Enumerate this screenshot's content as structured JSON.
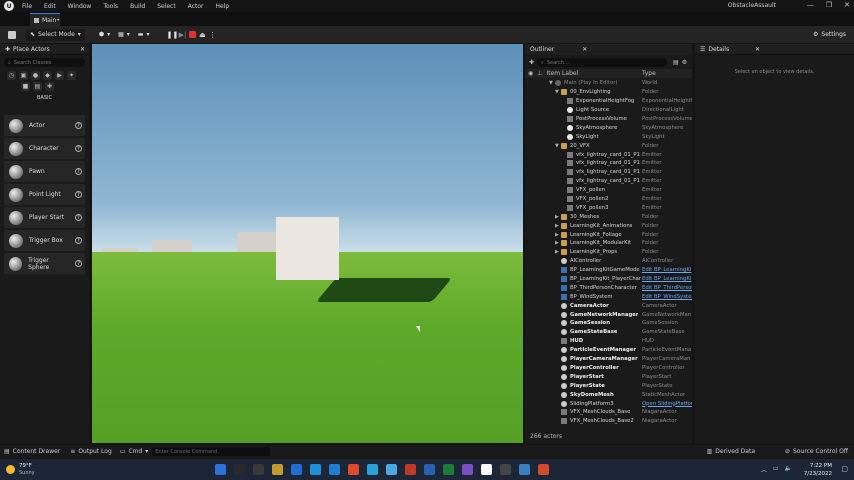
{
  "menubar": {
    "logo": "U",
    "items": [
      "File",
      "Edit",
      "Window",
      "Tools",
      "Build",
      "Select",
      "Actor",
      "Help"
    ],
    "project_name": "ObstacleAssault",
    "window_buttons": [
      "—",
      "❐",
      "✕"
    ]
  },
  "tabs": {
    "main": "Main•"
  },
  "toolbar": {
    "select_mode": "Select Mode",
    "settings": "Settings"
  },
  "place_actors": {
    "title": "Place Actors",
    "search_placeholder": "Search Classes",
    "section": "BASIC",
    "actors": [
      "Actor",
      "Character",
      "Pawn",
      "Point Light",
      "Player Start",
      "Trigger Box",
      "Trigger Sphere"
    ]
  },
  "outliner": {
    "title": "Outliner",
    "search_placeholder": "Search...",
    "col_label": "Item Label",
    "col_type": "Type",
    "rows": [
      {
        "indent": 0,
        "arrow": "▼",
        "icon": "world",
        "label": "Main (Play In Editor)",
        "type": "World",
        "dim": true
      },
      {
        "indent": 1,
        "arrow": "▼",
        "icon": "folder",
        "label": "00_EnvLighting",
        "type": "Folder"
      },
      {
        "indent": 2,
        "arrow": "",
        "icon": "fx",
        "label": "ExponentialHeightFog",
        "type": "ExponentialHeightF"
      },
      {
        "indent": 2,
        "arrow": "",
        "icon": "light",
        "label": "Light Source",
        "type": "DirectionalLight"
      },
      {
        "indent": 2,
        "arrow": "",
        "icon": "fx",
        "label": "PostProcessVolume",
        "type": "PostProcessVolume"
      },
      {
        "indent": 2,
        "arrow": "",
        "icon": "light",
        "label": "SkyAtmosphere",
        "type": "SkyAtmosphere"
      },
      {
        "indent": 2,
        "arrow": "",
        "icon": "light",
        "label": "SkyLight",
        "type": "SkyLight"
      },
      {
        "indent": 1,
        "arrow": "▼",
        "icon": "folder",
        "label": "20_VFX",
        "type": "Folder"
      },
      {
        "indent": 2,
        "arrow": "",
        "icon": "fx",
        "label": "vfx_lightray_card_01_P1",
        "type": "Emitter"
      },
      {
        "indent": 2,
        "arrow": "",
        "icon": "fx",
        "label": "vfx_lightray_card_01_P1",
        "type": "Emitter"
      },
      {
        "indent": 2,
        "arrow": "",
        "icon": "fx",
        "label": "vfx_lightray_card_01_P1",
        "type": "Emitter"
      },
      {
        "indent": 2,
        "arrow": "",
        "icon": "fx",
        "label": "vfx_lightray_card_01_P1",
        "type": "Emitter"
      },
      {
        "indent": 2,
        "arrow": "",
        "icon": "fx",
        "label": "VFX_pollen",
        "type": "Emitter"
      },
      {
        "indent": 2,
        "arrow": "",
        "icon": "fx",
        "label": "VFX_pollen2",
        "type": "Emitter"
      },
      {
        "indent": 2,
        "arrow": "",
        "icon": "fx",
        "label": "VFX_pollen3",
        "type": "Emitter"
      },
      {
        "indent": 1,
        "arrow": "▶",
        "icon": "folder",
        "label": "30_Meshes",
        "type": "Folder"
      },
      {
        "indent": 1,
        "arrow": "▶",
        "icon": "folder",
        "label": "LearningKit_Animations",
        "type": "Folder"
      },
      {
        "indent": 1,
        "arrow": "▶",
        "icon": "folder",
        "label": "LearningKit_Foliage",
        "type": "Folder"
      },
      {
        "indent": 1,
        "arrow": "▶",
        "icon": "folder",
        "label": "LearningKit_ModularKit",
        "type": "Folder"
      },
      {
        "indent": 1,
        "arrow": "▶",
        "icon": "folder",
        "label": "LearningKit_Props",
        "type": "Folder"
      },
      {
        "indent": 1,
        "arrow": "",
        "icon": "actor",
        "label": "AIController",
        "type": "AIController"
      },
      {
        "indent": 1,
        "arrow": "",
        "icon": "bp",
        "label": "BP_LearningKitGameMode",
        "type": "Edit BP_LearningKi",
        "link": true
      },
      {
        "indent": 1,
        "arrow": "",
        "icon": "bp",
        "label": "BP_LearningKit_PlayerChar",
        "type": "Edit BP_LearningKi",
        "link": true
      },
      {
        "indent": 1,
        "arrow": "",
        "icon": "bp",
        "label": "BP_ThirdPersonCharacter",
        "type": "Edit BP_ThirdPerson",
        "link": true
      },
      {
        "indent": 1,
        "arrow": "",
        "icon": "bp",
        "label": "BP_WindSystem",
        "type": "Edit BP_WindSystem",
        "link": true
      },
      {
        "indent": 1,
        "arrow": "",
        "icon": "actor",
        "label": "CameraActor",
        "type": "CameraActor",
        "bold": true
      },
      {
        "indent": 1,
        "arrow": "",
        "icon": "actor",
        "label": "GameNetworkManager",
        "type": "GameNetworkMan",
        "bold": true
      },
      {
        "indent": 1,
        "arrow": "",
        "icon": "actor",
        "label": "GameSession",
        "type": "GameSession",
        "bold": true
      },
      {
        "indent": 1,
        "arrow": "",
        "icon": "actor",
        "label": "GameStateBase",
        "type": "GameStateBase",
        "bold": true
      },
      {
        "indent": 1,
        "arrow": "",
        "icon": "fx",
        "label": "HUD",
        "type": "HUD",
        "bold": true
      },
      {
        "indent": 1,
        "arrow": "",
        "icon": "actor",
        "label": "ParticleEventManager",
        "type": "ParticleEventMana",
        "bold": true
      },
      {
        "indent": 1,
        "arrow": "",
        "icon": "actor",
        "label": "PlayerCameraManager",
        "type": "PlayerCameraMan",
        "bold": true
      },
      {
        "indent": 1,
        "arrow": "",
        "icon": "actor",
        "label": "PlayerController",
        "type": "PlayerController",
        "bold": true
      },
      {
        "indent": 1,
        "arrow": "",
        "icon": "actor",
        "label": "PlayerStart",
        "type": "PlayerStart",
        "bold": true
      },
      {
        "indent": 1,
        "arrow": "",
        "icon": "actor",
        "label": "PlayerState",
        "type": "PlayerState",
        "bold": true
      },
      {
        "indent": 1,
        "arrow": "",
        "icon": "actor",
        "label": "SkyDomeMesh",
        "type": "StaticMeshActor",
        "bold": true
      },
      {
        "indent": 1,
        "arrow": "",
        "icon": "actor",
        "label": "SlidingPlatform3",
        "type": "Open SlidingPlatfor",
        "link": true
      },
      {
        "indent": 1,
        "arrow": "",
        "icon": "fx",
        "label": "VFX_MeshClouds_Base",
        "type": "NiagaraActor"
      },
      {
        "indent": 1,
        "arrow": "",
        "icon": "fx",
        "label": "VFX_MeshClouds_Base2",
        "type": "NiagaraActor"
      }
    ],
    "count": "266 actors"
  },
  "details": {
    "title": "Details",
    "empty": "Select an object to view details."
  },
  "statusbar": {
    "content_drawer": "Content Drawer",
    "output_log": "Output Log",
    "cmd": "Cmd",
    "console_placeholder": "Enter Console Command",
    "derived_data": "Derived Data",
    "source_control": "Source Control Off"
  },
  "taskbar": {
    "weather_temp": "79°F",
    "weather_cond": "Sunny",
    "time": "7:22 PM",
    "date": "7/23/2022",
    "app_colors": [
      "#2a73d9",
      "#2a2a2a",
      "#3a3a3a",
      "#c49a2a",
      "#1e6fd1",
      "#1e90d8",
      "#1e7fd1",
      "#e04a2a",
      "#2aa0d8",
      "#4aa8e0",
      "#c0392b",
      "#2b5fb0",
      "#1f7a3a",
      "#7b4fc4",
      "#ffffff",
      "#444444",
      "#3a80c0",
      "#d04a30"
    ]
  }
}
